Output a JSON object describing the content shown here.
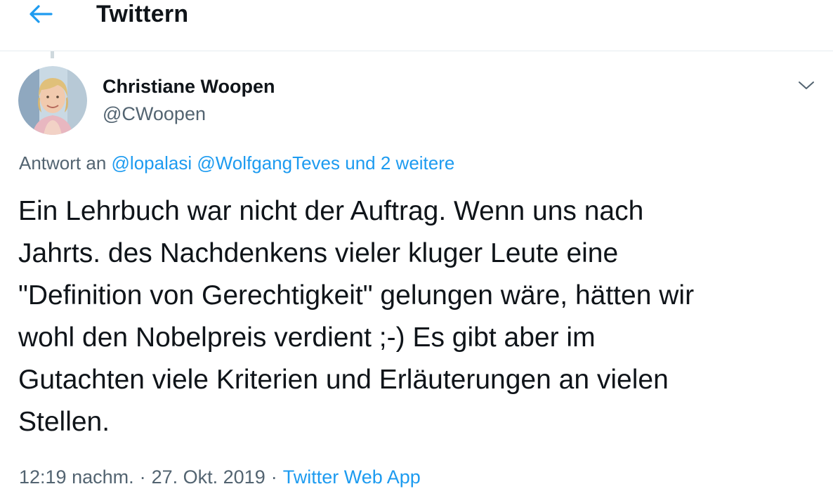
{
  "header": {
    "title": "Twittern",
    "back_icon": "arrow-left-icon",
    "accent_color": "#1d9bf0"
  },
  "author": {
    "name": "Christiane Woopen",
    "handle": "@CWoopen",
    "avatar_icon": "profile-photo"
  },
  "reply": {
    "prefix": "Antwort an",
    "mentions": [
      "@lopalasi",
      "@WolfgangTeves"
    ],
    "more": "und 2 weitere"
  },
  "tweet": {
    "text": "Ein Lehrbuch war nicht der Auftrag. Wenn uns nach\nJahrts. des Nachdenkens vieler kluger Leute eine\n\"Definition von Gerechtigkeit\" gelungen wäre, hätten wir\nwohl den Nobelpreis verdient ;-) Es gibt aber im\nGutachten viele Kriterien und Erläuterungen an vielen\nStellen."
  },
  "meta": {
    "time": "12:19 nachm.",
    "separator": "·",
    "date": "27. Okt. 2019",
    "source": "Twitter Web App"
  },
  "menu": {
    "caret_icon": "chevron-down-icon"
  }
}
